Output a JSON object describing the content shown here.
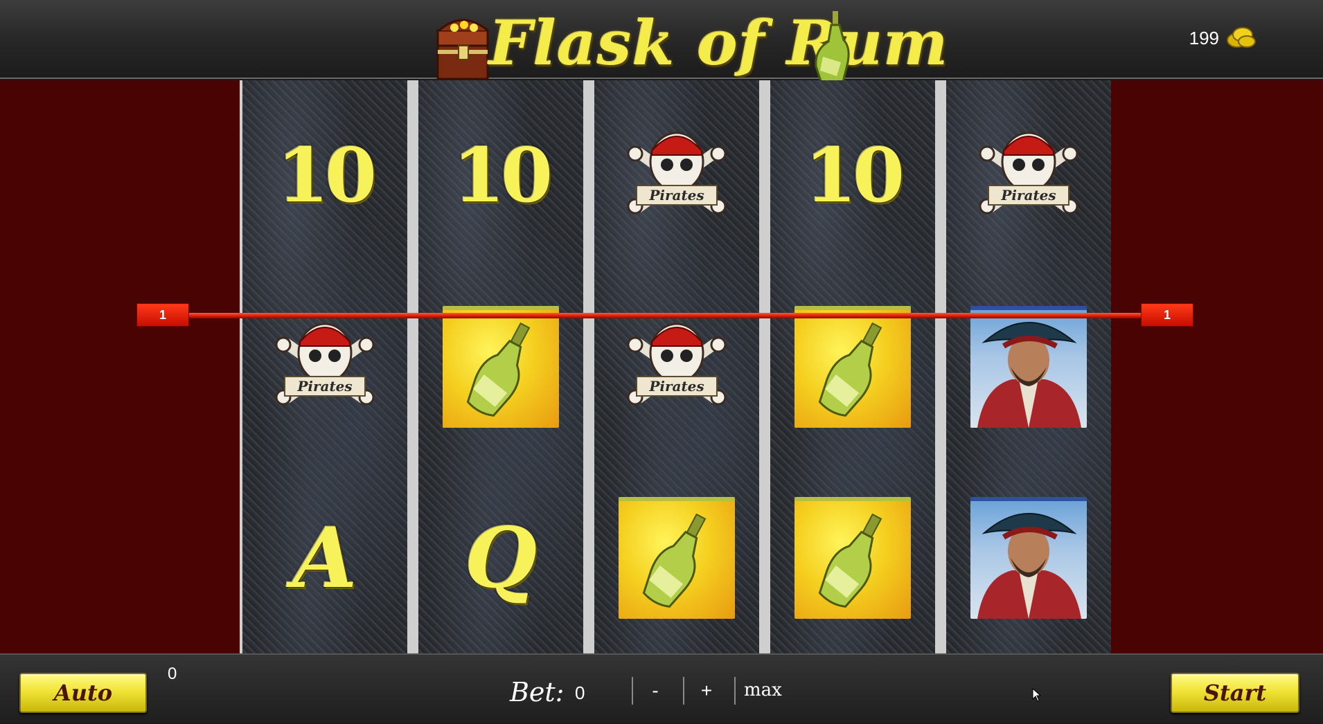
{
  "header": {
    "game_title": "Flask of Rum",
    "credits": "199",
    "logo_icons": [
      "treasure-chest-icon",
      "rum-bottle-icon"
    ],
    "credits_icon": "gold-coins-icon"
  },
  "reels": [
    [
      "10",
      "pirates-skull",
      "A"
    ],
    [
      "10",
      "rum-bottle",
      "Q"
    ],
    [
      "pirates-skull",
      "pirates-skull",
      "rum-bottle"
    ],
    [
      "10",
      "rum-bottle",
      "rum-bottle"
    ],
    [
      "pirates-skull",
      "pirate-portrait",
      "pirate-portrait"
    ]
  ],
  "symbols": {
    "pirates_banner": "Pirates"
  },
  "payline": {
    "left_label": "1",
    "right_label": "1",
    "color": "#e01c00"
  },
  "controls": {
    "auto_label": "Auto",
    "start_label": "Start",
    "win_value": "0",
    "bet_label": "Bet:",
    "bet_value": "0",
    "minus_label": "-",
    "plus_label": "+",
    "max_label": "max"
  },
  "colors": {
    "side_panel": "#4a0303",
    "gold_text": "#f4ec4a",
    "button_gold": "#f1e437"
  }
}
